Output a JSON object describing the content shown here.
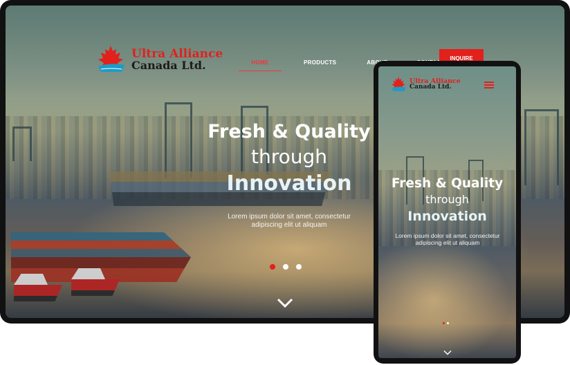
{
  "brand": {
    "name_line1": "Ultra Alliance",
    "name_line2": "Canada Ltd.",
    "primary_color": "#e2201c",
    "icon": "maple-leaf-ship-logo"
  },
  "desktop": {
    "nav": {
      "items": [
        {
          "label": "HOME",
          "active": true
        },
        {
          "label": "PRODUCTS",
          "active": false
        },
        {
          "label": "ABOUT",
          "active": false
        },
        {
          "label": "CONTACT",
          "active": false
        }
      ],
      "cta_label": "INQUIRE"
    },
    "hero": {
      "line1": "Fresh & Quality",
      "line2": "through",
      "line3": "Innovation",
      "subtitle_line1": "Lorem ipsum dolor sit amet, consectetur",
      "subtitle_line2": "adipiscing elit ut aliquam"
    },
    "slider": {
      "count": 3,
      "active_index": 0
    },
    "scroll_icon": "chevron-down-icon"
  },
  "mobile": {
    "menu_icon": "hamburger-icon",
    "hero": {
      "line1": "Fresh & Quality",
      "line2": "through",
      "line3": "Innovation",
      "subtitle_line1": "Lorem ipsum dolor sit amet, consectetur",
      "subtitle_line2": "adipiscing elit ut aliquam"
    },
    "slider": {
      "count": 2,
      "active_index": 0
    }
  }
}
